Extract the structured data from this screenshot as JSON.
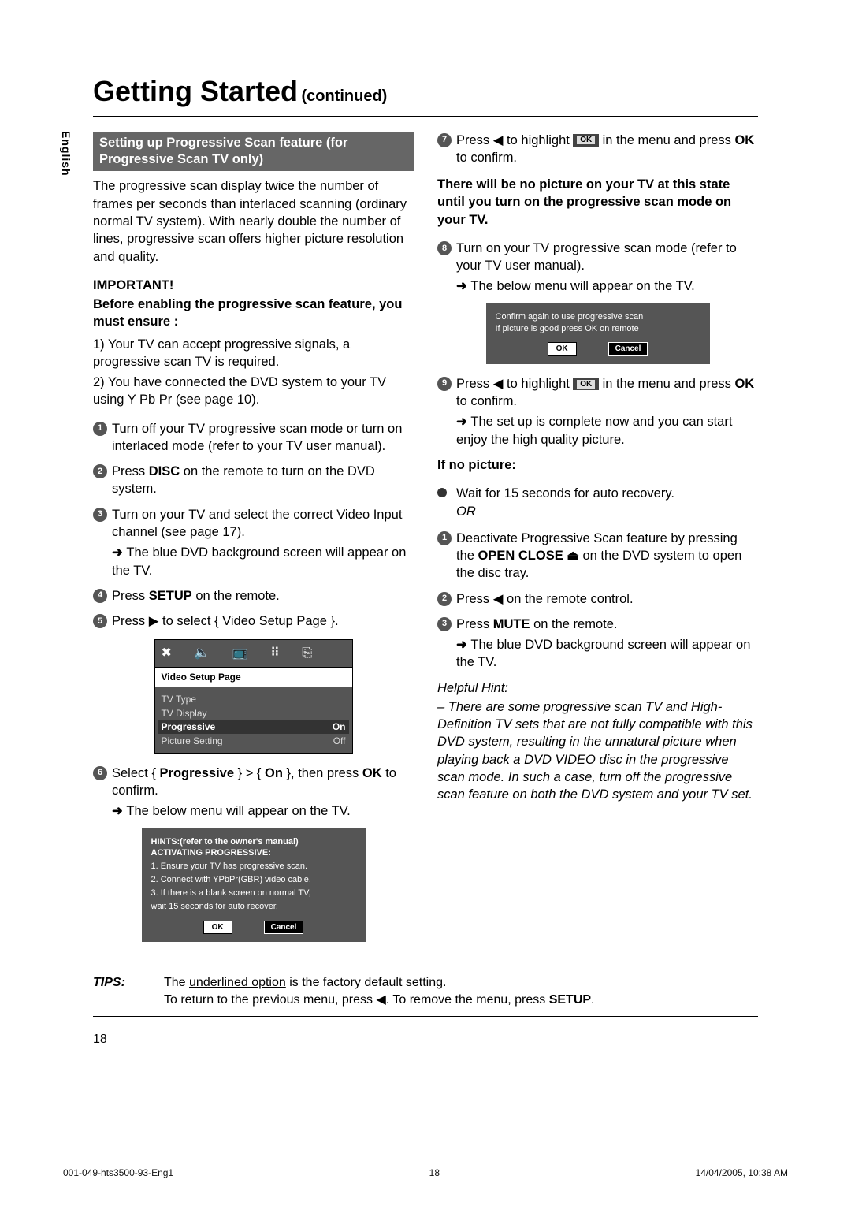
{
  "title": {
    "main": "Getting Started",
    "cont": " (continued)"
  },
  "lang_tab": "English",
  "left": {
    "section_heading": "Setting up Progressive Scan feature (for Progressive Scan TV only)",
    "intro": "The progressive scan display twice the number of frames per seconds than interlaced scanning (ordinary normal TV system).  With nearly double the number of lines, progressive scan offers higher picture resolution and quality.",
    "important_label": "IMPORTANT!",
    "important_text": "Before enabling the progressive scan feature, you must ensure :",
    "req1": "1) Your TV can accept progressive signals, a progressive scan TV is required.",
    "req2": "2) You have connected the DVD system to your TV using Y Pb Pr (see page 10).",
    "step1": "Turn off your TV progressive scan mode or turn on interlaced mode (refer to your TV user manual).",
    "step2_pre": "Press ",
    "step2_bold": "DISC",
    "step2_post": " on the remote to turn on the DVD system.",
    "step3": "Turn on your TV and select the correct Video Input channel (see page 17).",
    "step3_sub": "The blue DVD background screen will appear on the TV.",
    "step4_pre": "Press ",
    "step4_bold": "SETUP",
    "step4_post": " on the remote.",
    "step5_pre": "Press ",
    "step5_post": " to select { Video Setup Page }.",
    "osd1": {
      "title": "Video Setup Page",
      "rows": [
        {
          "l": "TV Type",
          "r": ""
        },
        {
          "l": "TV Display",
          "r": ""
        },
        {
          "l": "Progressive",
          "r": "On"
        },
        {
          "l": "Picture Setting",
          "r": "Off"
        }
      ]
    },
    "step6_a": "Select { ",
    "step6_b": "Progressive",
    "step6_c": " } > { ",
    "step6_d": "On",
    "step6_e": " }, then press ",
    "step6_f": "OK",
    "step6_g": " to confirm.",
    "step6_sub": "The below menu will appear on the TV.",
    "osd2": {
      "t1": "HINTS:(refer to the owner's manual)",
      "t2": "ACTIVATING PROGRESSIVE:",
      "l1": "1. Ensure your TV has progressive scan.",
      "l2": "2. Connect with YPbPr(GBR) video cable.",
      "l3": "3. If there is a blank screen on normal TV,",
      "l4": "    wait 15 seconds for auto recover.",
      "ok": "OK",
      "cancel": "Cancel"
    }
  },
  "right": {
    "step7_a": "Press ",
    "step7_b": " to highlight ",
    "step7_c": " in the menu and press ",
    "step7_d": "OK",
    "step7_e": " to confirm.",
    "warn": "There will be no picture on your TV at this state until you turn on the progressive scan mode on your TV.",
    "step8": "Turn on your TV progressive scan mode (refer to your TV user manual).",
    "step8_sub": "The below menu will appear on the TV.",
    "osd3": {
      "l1": "Confirm again to use progressive scan",
      "l2": "If picture is good press OK on remote",
      "ok": "OK",
      "cancel": "Cancel"
    },
    "step9_a": "Press ",
    "step9_b": " to highlight ",
    "step9_c": " in the menu and press ",
    "step9_d": "OK",
    "step9_e": " to confirm.",
    "step9_sub": "The set up is complete now and you can start enjoy the high quality picture.",
    "no_picture_label": "If no picture:",
    "no_picture_bullet": "Wait for 15 seconds for auto recovery.",
    "or": "OR",
    "np1_a": "Deactivate Progressive Scan feature by pressing the ",
    "np1_b": "OPEN CLOSE ",
    "np1_c": " on the DVD system to open the disc tray.",
    "np2_a": "Press ",
    "np2_b": " on the remote control.",
    "np3_a": "Press ",
    "np3_b": "MUTE",
    "np3_c": " on the remote.",
    "np3_sub": "The blue DVD background screen will appear on the TV.",
    "hint_label": "Helpful Hint:",
    "hint_body": "–  There are some progressive scan TV and High-Definition TV sets that are not fully compatible with this DVD system, resulting in the unnatural picture when playing back a DVD VIDEO disc in the progressive scan mode.  In such a case, turn off the progressive scan feature on both the DVD system and your TV set."
  },
  "tips": {
    "label": "TIPS:",
    "line1_a": "The ",
    "line1_u": "underlined option",
    "line1_b": " is the factory default setting.",
    "line2_a": "To return to the previous menu, press ",
    "line2_b": ".  To remove the menu, press ",
    "line2_c": "SETUP",
    "line2_d": "."
  },
  "page_number": "18",
  "footer": {
    "left": "001-049-hts3500-93-Eng1",
    "mid": "18",
    "right": "14/04/2005, 10:38 AM"
  },
  "ok_chip": "OK"
}
